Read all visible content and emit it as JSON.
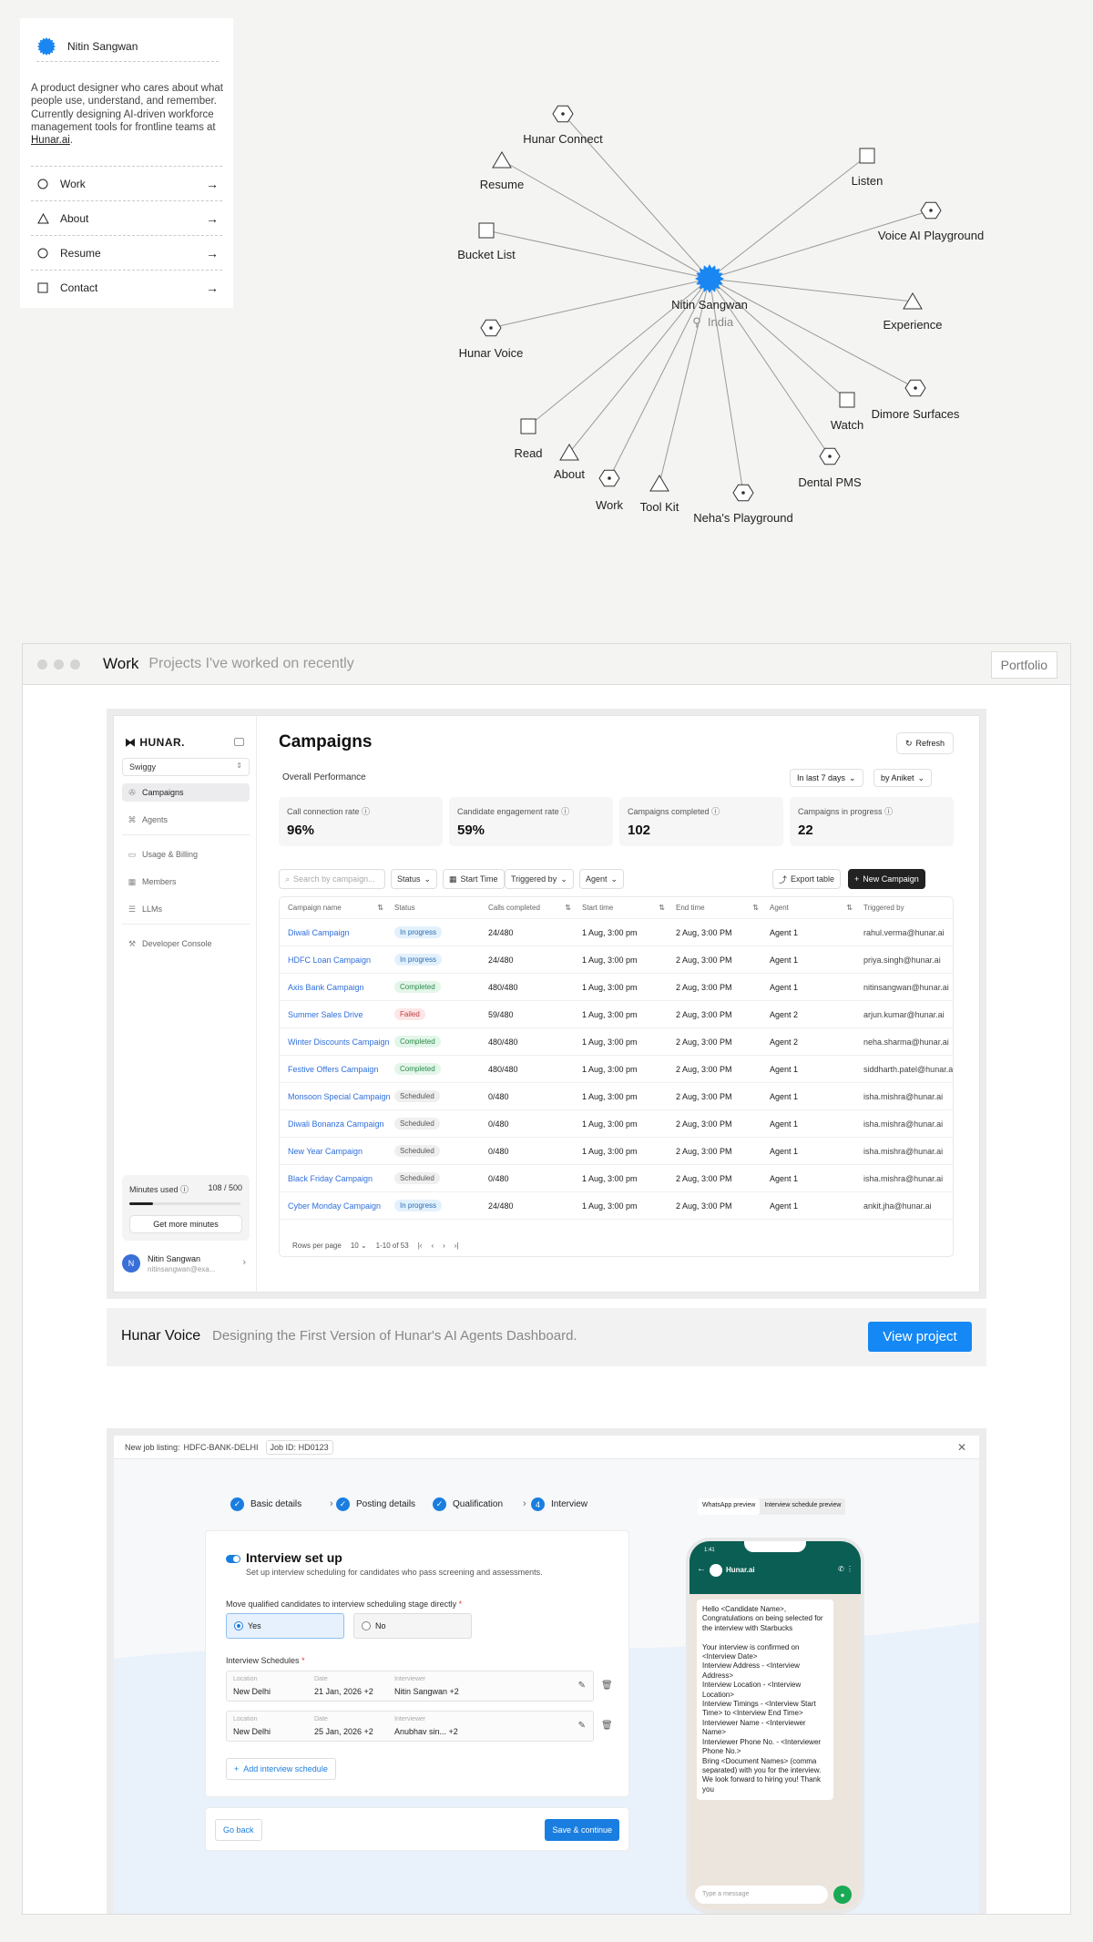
{
  "profile": {
    "name": "Nitin Sangwan",
    "bio_prefix": "A product designer who cares about what people use, understand, and remember. Currently designing AI-driven workforce management tools for frontline teams at ",
    "bio_link": "Hunar.ai",
    "bio_suffix": ".",
    "nav": [
      {
        "label": "Work",
        "icon": "circle-icon"
      },
      {
        "label": "About",
        "icon": "triangle-icon"
      },
      {
        "label": "Resume",
        "icon": "circle-icon"
      },
      {
        "label": "Contact",
        "icon": "square-icon"
      }
    ],
    "accent": "#1a86f2"
  },
  "graph": {
    "center_name": "Nitin Sangwan",
    "center_location": "India",
    "nodes": [
      {
        "label": "Hunar Connect",
        "shape": "hexagon"
      },
      {
        "label": "Resume",
        "shape": "triangle"
      },
      {
        "label": "Bucket List",
        "shape": "square"
      },
      {
        "label": "Hunar Voice",
        "shape": "hexagon"
      },
      {
        "label": "Read",
        "shape": "square"
      },
      {
        "label": "About",
        "shape": "triangle"
      },
      {
        "label": "Work",
        "shape": "hexagon"
      },
      {
        "label": "Tool Kit",
        "shape": "triangle"
      },
      {
        "label": "Neha's Playground",
        "shape": "hexagon"
      },
      {
        "label": "Dental PMS",
        "shape": "hexagon"
      },
      {
        "label": "Watch",
        "shape": "square"
      },
      {
        "label": "Dimore Surfaces",
        "shape": "hexagon"
      },
      {
        "label": "Experience",
        "shape": "triangle"
      },
      {
        "label": "Voice AI Playground",
        "shape": "hexagon"
      },
      {
        "label": "Listen",
        "shape": "square"
      }
    ]
  },
  "work": {
    "title": "Work",
    "subtitle": "Projects I've worked on recently",
    "portfolio_label": "Portfolio"
  },
  "dashboard": {
    "logo": "HUNAR.",
    "org": "Swiggy",
    "sidebar": [
      {
        "label": "Campaigns",
        "icon": "megaphone-icon",
        "active": true
      },
      {
        "label": "Agents",
        "icon": "agents-icon"
      },
      {
        "label": "Usage & Billing",
        "icon": "billing-icon"
      },
      {
        "label": "Members",
        "icon": "members-icon"
      },
      {
        "label": "LLMs",
        "icon": "llm-icon"
      },
      {
        "label": "Developer Console",
        "icon": "wrench-icon"
      }
    ],
    "minutes_label": "Minutes used",
    "minutes_value": "108 / 500",
    "minutes_fraction": 0.216,
    "get_more": "Get more minutes",
    "user_name": "Nitin Sangwan",
    "user_email": "nitinsangwan@exa...",
    "user_initial": "N",
    "title": "Campaigns",
    "refresh": "Refresh",
    "overall": "Overall Performance",
    "filter_period": "In last 7 days",
    "filter_by": "by Aniket",
    "kpis": [
      {
        "label": "Call connection rate",
        "value": "96%"
      },
      {
        "label": "Candidate engagement rate",
        "value": "59%"
      },
      {
        "label": "Campaigns completed",
        "value": "102"
      },
      {
        "label": "Campaigns in progress",
        "value": "22"
      }
    ],
    "search_placeholder": "Search by campaign...",
    "toolbar": {
      "status": "Status",
      "start_time": "Start Time",
      "triggered_by": "Triggered by",
      "agent": "Agent",
      "export": "Export table",
      "new": "New Campaign"
    },
    "columns": [
      "Campaign name",
      "Status",
      "Calls completed",
      "Start time",
      "End time",
      "Agent",
      "Triggered by"
    ],
    "rows": [
      [
        "Diwali Campaign",
        "In progress",
        "24/480",
        "1 Aug, 3:00 pm",
        "2 Aug, 3:00 PM",
        "Agent 1",
        "rahul.verma@hunar.ai"
      ],
      [
        "HDFC Loan Campaign",
        "In progress",
        "24/480",
        "1 Aug, 3:00 pm",
        "2 Aug, 3:00 PM",
        "Agent 1",
        "priya.singh@hunar.ai"
      ],
      [
        "Axis Bank Campaign",
        "Completed",
        "480/480",
        "1 Aug, 3:00 pm",
        "2 Aug, 3:00 PM",
        "Agent 1",
        "nitinsangwan@hunar.ai"
      ],
      [
        "Summer Sales Drive",
        "Failed",
        "59/480",
        "1 Aug, 3:00 pm",
        "2 Aug, 3:00 PM",
        "Agent 2",
        "arjun.kumar@hunar.ai"
      ],
      [
        "Winter Discounts Campaign",
        "Completed",
        "480/480",
        "1 Aug, 3:00 pm",
        "2 Aug, 3:00 PM",
        "Agent 2",
        "neha.sharma@hunar.ai"
      ],
      [
        "Festive Offers Campaign",
        "Completed",
        "480/480",
        "1 Aug, 3:00 pm",
        "2 Aug, 3:00 PM",
        "Agent 1",
        "siddharth.patel@hunar.ai"
      ],
      [
        "Monsoon Special Campaign",
        "Scheduled",
        "0/480",
        "1 Aug, 3:00 pm",
        "2 Aug, 3:00 PM",
        "Agent 1",
        "isha.mishra@hunar.ai"
      ],
      [
        "Diwali Bonanza Campaign",
        "Scheduled",
        "0/480",
        "1 Aug, 3:00 pm",
        "2 Aug, 3:00 PM",
        "Agent 1",
        "isha.mishra@hunar.ai"
      ],
      [
        "New Year Campaign",
        "Scheduled",
        "0/480",
        "1 Aug, 3:00 pm",
        "2 Aug, 3:00 PM",
        "Agent 1",
        "isha.mishra@hunar.ai"
      ],
      [
        "Black Friday Campaign",
        "Scheduled",
        "0/480",
        "1 Aug, 3:00 pm",
        "2 Aug, 3:00 PM",
        "Agent 1",
        "isha.mishra@hunar.ai"
      ],
      [
        "Cyber Monday Campaign",
        "In progress",
        "24/480",
        "1 Aug, 3:00 pm",
        "2 Aug, 3:00 PM",
        "Agent 1",
        "ankit.jha@hunar.ai"
      ]
    ],
    "status_colors": {
      "In progress": {
        "bg": "#e3f1fd",
        "fg": "#2a6db5"
      },
      "Completed": {
        "bg": "#e3f6e9",
        "fg": "#2b8a4a"
      },
      "Failed": {
        "bg": "#fde6e6",
        "fg": "#c23b3b"
      },
      "Scheduled": {
        "bg": "#efefef",
        "fg": "#555555"
      }
    },
    "rows_per_page": "Rows per page",
    "rows_per_page_value": "10",
    "range": "1-10 of 53"
  },
  "caption": {
    "title": "Hunar Voice",
    "subtitle": "Designing the First Version of Hunar's AI Agents Dashboard.",
    "button": "View project"
  },
  "interview": {
    "listing_label": "New job listing:",
    "listing_value": "HDFC-BANK-DELHI",
    "job_id_label": "Job ID:",
    "job_id_value": "HD0123",
    "steps": [
      "Basic details",
      "Posting details",
      "Qualification",
      "Interview"
    ],
    "step_current_number": "4",
    "title": "Interview set up",
    "subtitle": "Set up interview scheduling for candidates who pass screening and assessments.",
    "question": "Move qualified candidates to interview scheduling stage directly",
    "options": [
      "Yes",
      "No"
    ],
    "schedules_label": "Interview Schedules",
    "field_labels": {
      "location": "Location",
      "date": "Date",
      "interviewer": "Interviewer"
    },
    "schedules": [
      {
        "location": "New Delhi",
        "date": "21 Jan, 2026 +2",
        "interviewer": "Nitin Sangwan  +2"
      },
      {
        "location": "New Delhi",
        "date": "25 Jan, 2026 +2",
        "interviewer": "Anubhav sin...  +2"
      }
    ],
    "add_schedule": "Add interview schedule",
    "go_back": "Go back",
    "save": "Save & continue",
    "preview_tabs": [
      "WhatsApp preview",
      "Interview schedule preview"
    ],
    "wa_time": "1:41",
    "wa_name": "Hunar.ai",
    "wa_message": "Hello <Candidate Name>,\nCongratulations on being selected for the interview with Starbucks\n\nYour interview is confirmed on <Interview Date>\nInterview Address - <Interview Address>\nInterview Location - <Interview Location>\nInterview Timings - <Interview Start Time> to <Interview End Time>\nInterviewer Name - <Interviewer Name>\nInterviewer Phone No. - <Interviewer Phone No.>\nBring <Document Names> (comma separated) with you for the interview. We look forward to hiring you! Thank you",
    "wa_input_placeholder": "Type a message"
  }
}
